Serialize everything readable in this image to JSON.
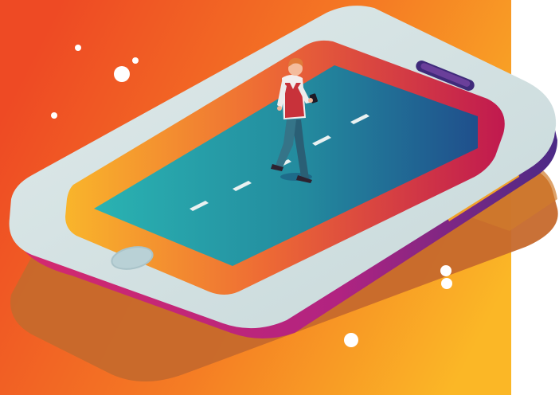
{
  "illustration": {
    "subject": "",
    "colors": {
      "background_start": "#ee4a24",
      "background_end": "#fbb726",
      "phone_body": "#cfdfe0",
      "phone_edge_magenta": "#c72273",
      "phone_edge_purple": "#5b2a86",
      "screen_left": "#f7a12a",
      "screen_right": "#c0194f",
      "road_left": "#2aa9b0",
      "road_right": "#1f4f8c",
      "shadow": "#b9642a",
      "sparkle": "#ffffff"
    },
    "icons": [
      "phone-illustration",
      "walking-man-figure",
      "sparkle-dot"
    ]
  }
}
